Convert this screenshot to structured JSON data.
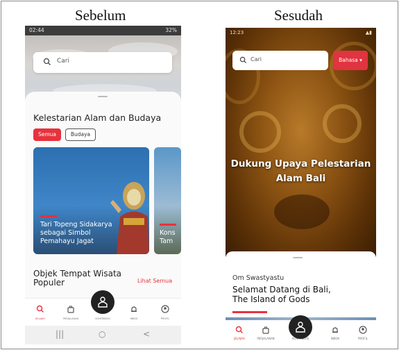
{
  "captions": {
    "before": "Sebelum",
    "after": "Sesudah"
  },
  "before": {
    "status": {
      "time": "02:44",
      "right": "32%"
    },
    "search_placeholder": "Cari",
    "section_title": "Kelestarian Alam dan Budaya",
    "chips": [
      {
        "label": "Semua",
        "active": true
      },
      {
        "label": "Budaya",
        "active": false
      }
    ],
    "cards": [
      {
        "lines": [
          "Tari Topeng Sidakarya",
          "sebagai Simbol",
          "Pemahayu Jagat"
        ]
      },
      {
        "lines": [
          "Kons",
          "Tam"
        ]
      }
    ],
    "objects_title_lines": [
      "Objek Tempat Wisata",
      "Populer"
    ],
    "see_all": "Lihat Semua",
    "nav": [
      "JELAJAH",
      "PERJALANAN",
      "KONTRIBUSI",
      "INBOX",
      "PROFIL"
    ],
    "android_nav": [
      "|||",
      "○",
      "<"
    ]
  },
  "after": {
    "status": {
      "time": "12:23"
    },
    "search_placeholder": "Cari",
    "language_button": "Bahasa ▾",
    "hero_title_lines": [
      "Dukung Upaya Pelestarian",
      "Alam Bali"
    ],
    "greeting": "Om Swastyastu",
    "welcome_lines": [
      "Selamat Datang di Bali,",
      "The Island of Gods"
    ],
    "nav": [
      "JELAJAH",
      "PERJALANAN",
      "KONTRIBUSI",
      "INBOX",
      "PROFIL"
    ]
  },
  "colors": {
    "accent": "#e8323c",
    "fab": "#222222",
    "hero_gold": "#b87a2a"
  }
}
